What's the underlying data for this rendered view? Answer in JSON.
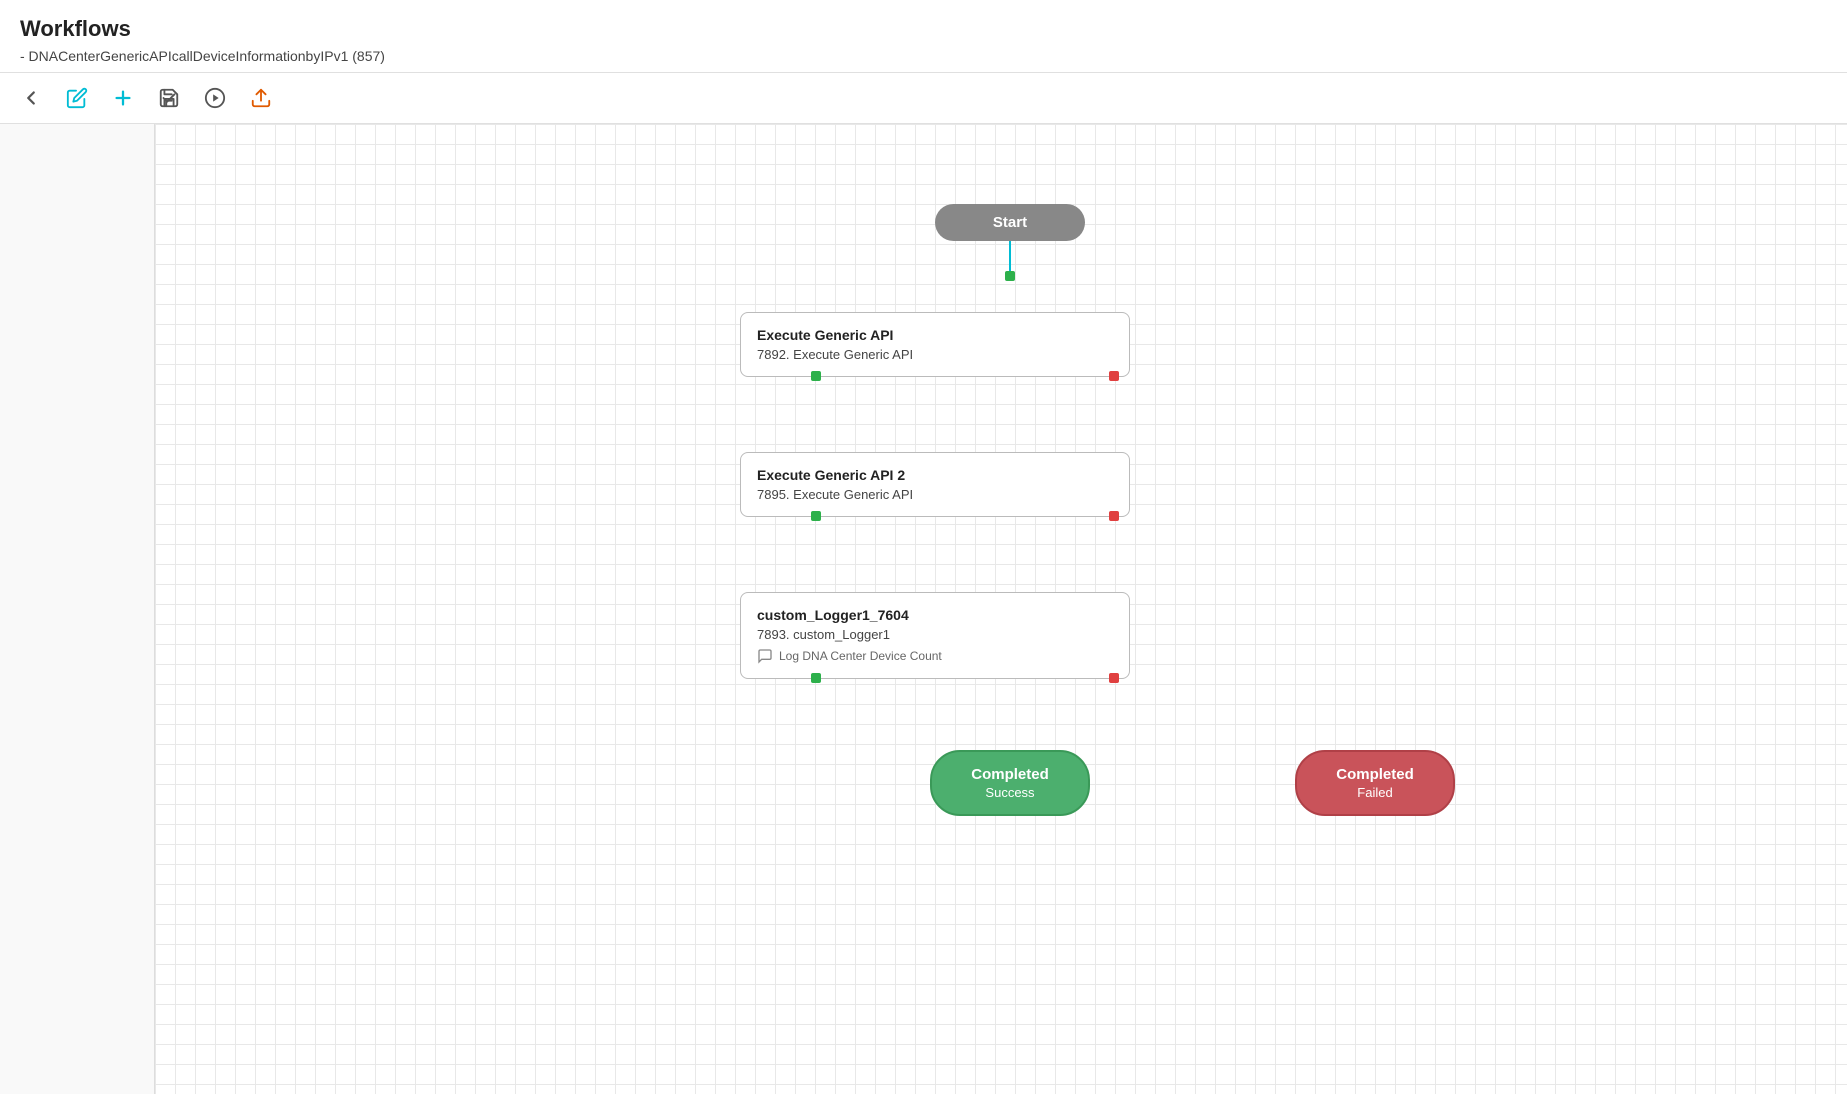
{
  "header": {
    "title": "Workflows",
    "breadcrumb": "- DNACenterGenericAPIcallDeviceInformationbyIPv1 (857)"
  },
  "toolbar": {
    "back_label": "Back",
    "edit_icon": "pencil-icon",
    "add_icon": "plus-icon",
    "save_icon": "save-icon",
    "run_icon": "play-icon",
    "export_icon": "export-icon"
  },
  "workflow": {
    "start_label": "Start",
    "nodes": [
      {
        "id": "execute-generic-api-1",
        "title": "Execute Generic API",
        "subtitle": "7892. Execute Generic API"
      },
      {
        "id": "execute-generic-api-2",
        "title": "Execute Generic API 2",
        "subtitle": "7895. Execute Generic API"
      },
      {
        "id": "custom-logger",
        "title": "custom_Logger1_7604",
        "subtitle": "7893. custom_Logger1",
        "note": "Log DNA Center Device Count"
      }
    ],
    "end_nodes": [
      {
        "id": "completed-success",
        "label": "Completed",
        "sublabel": "Success",
        "type": "success"
      },
      {
        "id": "completed-failed",
        "label": "Completed",
        "sublabel": "Failed",
        "type": "failed"
      }
    ]
  }
}
